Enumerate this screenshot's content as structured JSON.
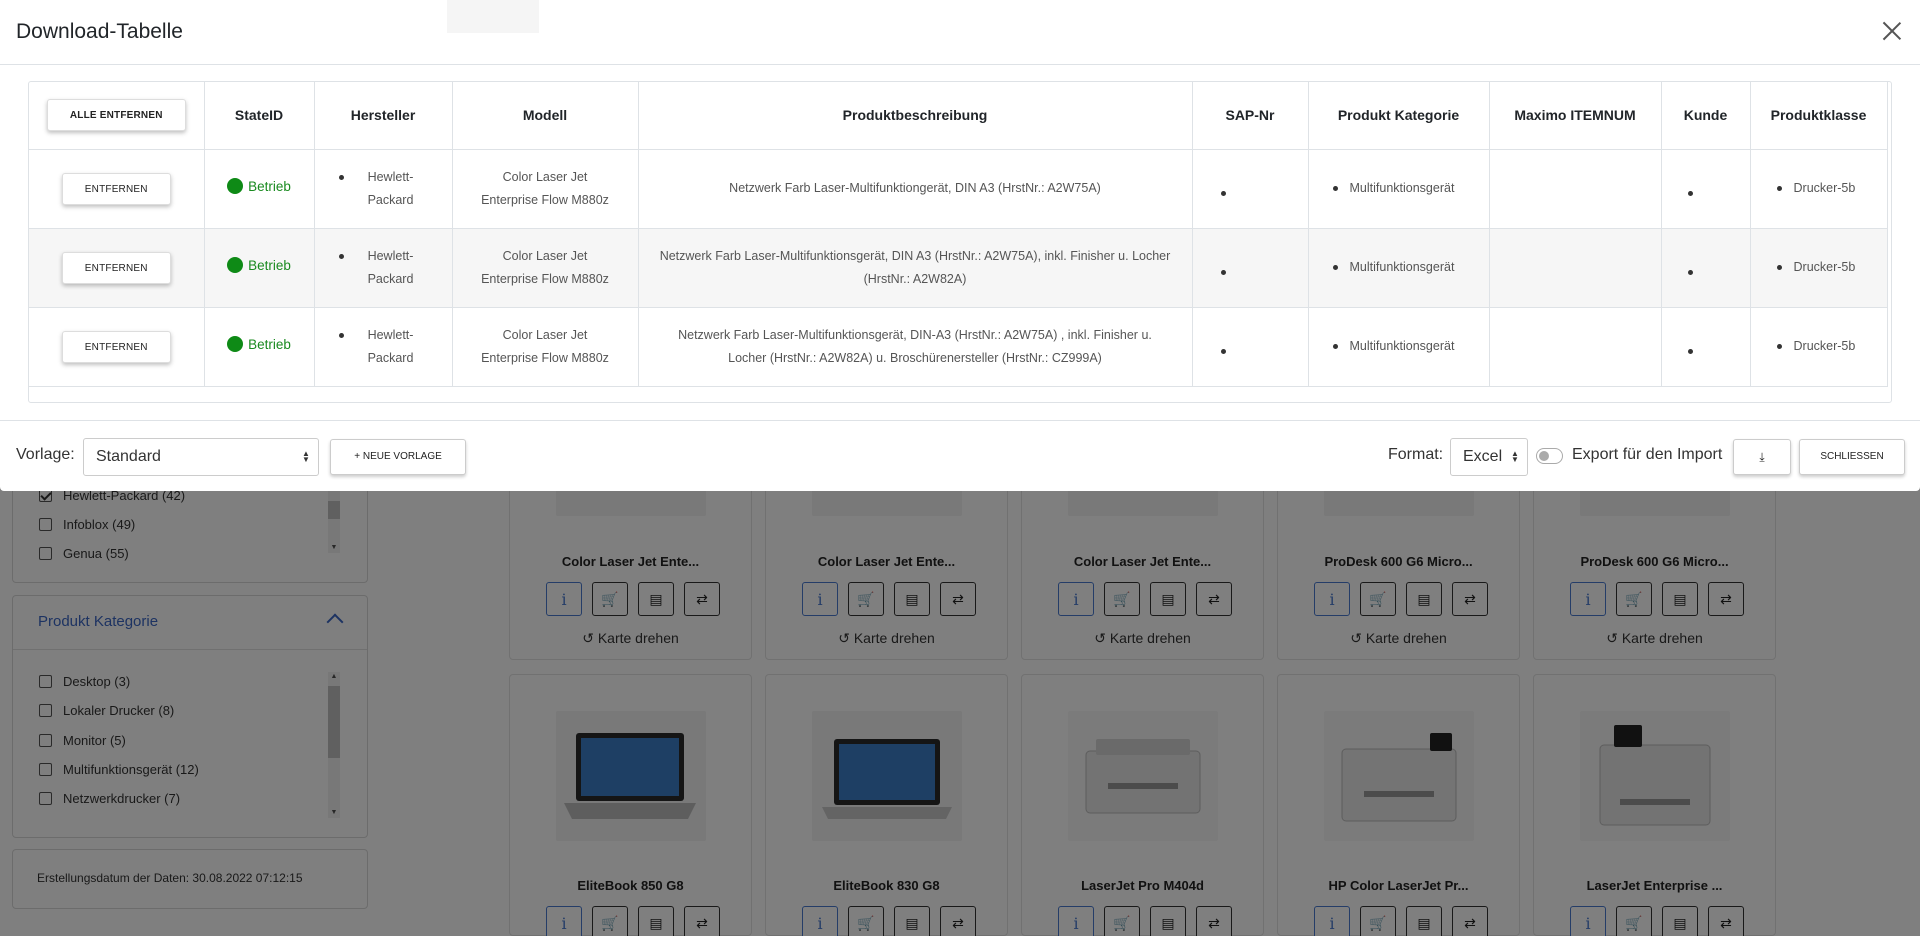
{
  "modal": {
    "title": "Download-Tabelle",
    "remove_all_label": "ALLE ENTFERNEN",
    "columns": [
      "StateID",
      "Hersteller",
      "Modell",
      "Produktbeschreibung",
      "SAP-Nr",
      "Produkt Kategorie",
      "Maximo ITEMNUM",
      "Kunde",
      "Produktklasse"
    ],
    "rows": [
      {
        "remove_label": "ENTFERNEN",
        "state": "Betrieb",
        "hersteller": "Hewlett-Packard",
        "modell": "Color Laser Jet Enterprise Flow M880z",
        "beschreibung": "Netzwerk Farb Laser-Multifunktiongerät,  DIN A3 (HrstNr.: A2W75A)",
        "sap": "",
        "kategorie": "Multifunktionsgerät",
        "maximo": "",
        "kunde": "",
        "klasse": "Drucker-5b"
      },
      {
        "remove_label": "ENTFERNEN",
        "state": "Betrieb",
        "hersteller": "Hewlett-Packard",
        "modell": "Color Laser Jet Enterprise Flow M880z",
        "beschreibung": "Netzwerk Farb Laser-Multifunktionsgerät, DIN A3 (HrstNr.: A2W75A), inkl. Finisher u. Locher (HrstNr.: A2W82A)",
        "sap": "",
        "kategorie": "Multifunktionsgerät",
        "maximo": "",
        "kunde": "",
        "klasse": "Drucker-5b"
      },
      {
        "remove_label": "ENTFERNEN",
        "state": "Betrieb",
        "hersteller": "Hewlett-Packard",
        "modell": "Color Laser Jet Enterprise Flow M880z",
        "beschreibung": "Netzwerk Farb Laser-Multifunktionsgerät, DIN-A3 (HrstNr.: A2W75A) , inkl. Finisher u. Locher (HrstNr.: A2W82A) u. Broschürenersteller (HrstNr.: CZ999A)",
        "sap": "",
        "kategorie": "Multifunktionsgerät",
        "maximo": "",
        "kunde": "",
        "klasse": "Drucker-5b"
      }
    ],
    "footer": {
      "vorlage_label": "Vorlage:",
      "vorlage_value": "Standard",
      "new_template_label": "+ NEUE VORLAGE",
      "format_label": "Format:",
      "format_value": "Excel",
      "export_toggle_label": "Export für den Import",
      "close_label": "SCHLIESSEN"
    }
  },
  "background": {
    "manufacturer_filters": [
      {
        "label": "Hewlett-Packard (42)",
        "checked": true
      },
      {
        "label": "Infoblox (49)",
        "checked": false
      },
      {
        "label": "Genua (55)",
        "checked": false
      }
    ],
    "category_panel": {
      "title": "Produkt Kategorie",
      "items": [
        "Desktop (3)",
        "Lokaler Drucker (8)",
        "Monitor (5)",
        "Multifunktionsgerät (12)",
        "Netzwerkdrucker (7)"
      ]
    },
    "date_text": "Erstellungsdatum der Daten: 30.08.2022 07:12:15",
    "flip_label": "Karte drehen",
    "cards_row1": [
      "Color Laser Jet Ente...",
      "Color Laser Jet Ente...",
      "Color Laser Jet Ente...",
      "ProDesk 600 G6 Micro...",
      "ProDesk 600 G6 Micro..."
    ],
    "cards_row2": [
      "EliteBook 850 G8",
      "EliteBook 830 G8",
      "LaserJet Pro M404d",
      "HP Color LaserJet Pr...",
      "LaserJet Enterprise ..."
    ]
  },
  "colors": {
    "accent": "#3b66c4",
    "status_green": "#0e8a16",
    "overlay": "rgba(0,0,0,0.5)"
  }
}
